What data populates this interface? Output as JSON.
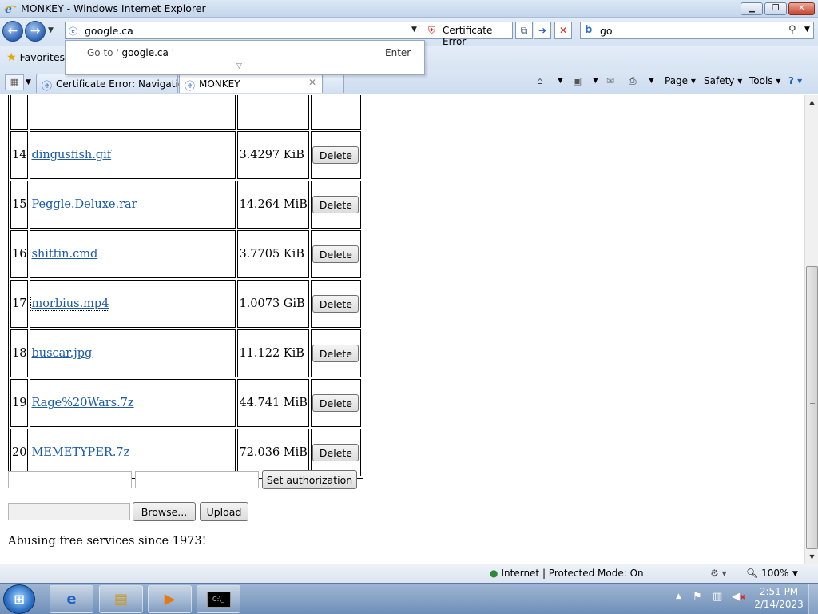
{
  "window": {
    "title": "MONKEY - Windows Internet Explorer",
    "min_glyph": "▁",
    "max_glyph": "❐",
    "close_glyph": "✕"
  },
  "address_bar": {
    "url": "google.ca",
    "cert_error_label": "Certificate Error",
    "search_value": "go"
  },
  "autocomplete": {
    "goto_prefix": "Go to '",
    "goto_url": "google.ca",
    "goto_suffix": "'",
    "enter_label": "Enter"
  },
  "favorites": {
    "label": "Favorites"
  },
  "tabs": [
    {
      "label": "Certificate Error: Navigatio..."
    },
    {
      "label": "MONKEY"
    }
  ],
  "command_bar": {
    "page_label": "Page",
    "safety_label": "Safety",
    "tools_label": "Tools"
  },
  "files": [
    {
      "num": "14",
      "name": "dingusfish.gif",
      "size": "3.4297 KiB",
      "action": "Delete"
    },
    {
      "num": "15",
      "name": "Peggle.Deluxe.rar",
      "size": "14.264 MiB",
      "action": "Delete"
    },
    {
      "num": "16",
      "name": "shittin.cmd",
      "size": "3.7705 KiB",
      "action": "Delete"
    },
    {
      "num": "17",
      "name": "morbius.mp4",
      "size": "1.0073 GiB",
      "action": "Delete"
    },
    {
      "num": "18",
      "name": "buscar.jpg",
      "size": "11.122 KiB",
      "action": "Delete"
    },
    {
      "num": "19",
      "name": "Rage%20Wars.7z",
      "size": "44.741 MiB",
      "action": "Delete"
    },
    {
      "num": "20",
      "name": "MEMETYPER.7z",
      "size": "72.036 MiB",
      "action": "Delete"
    }
  ],
  "forms": {
    "auth_button": "Set authorization",
    "browse_button": "Browse...",
    "upload_button": "Upload"
  },
  "footer": {
    "text": "Abusing free services since 1973!"
  },
  "status_bar": {
    "zone": "Internet | Protected Mode: On",
    "zoom": "100%"
  },
  "taskbar": {
    "time": "2:51 PM",
    "date": "2/14/2023"
  },
  "icons": {
    "ie": "ie-logo-icon",
    "back": "back-arrow-icon",
    "forward": "forward-arrow-icon",
    "cert": "shield-error-icon",
    "search": "magnifier-icon",
    "star": "star-icon",
    "home": "home-icon",
    "feeds": "rss-icon",
    "mail": "mail-icon",
    "print": "printer-icon",
    "help": "help-icon"
  }
}
